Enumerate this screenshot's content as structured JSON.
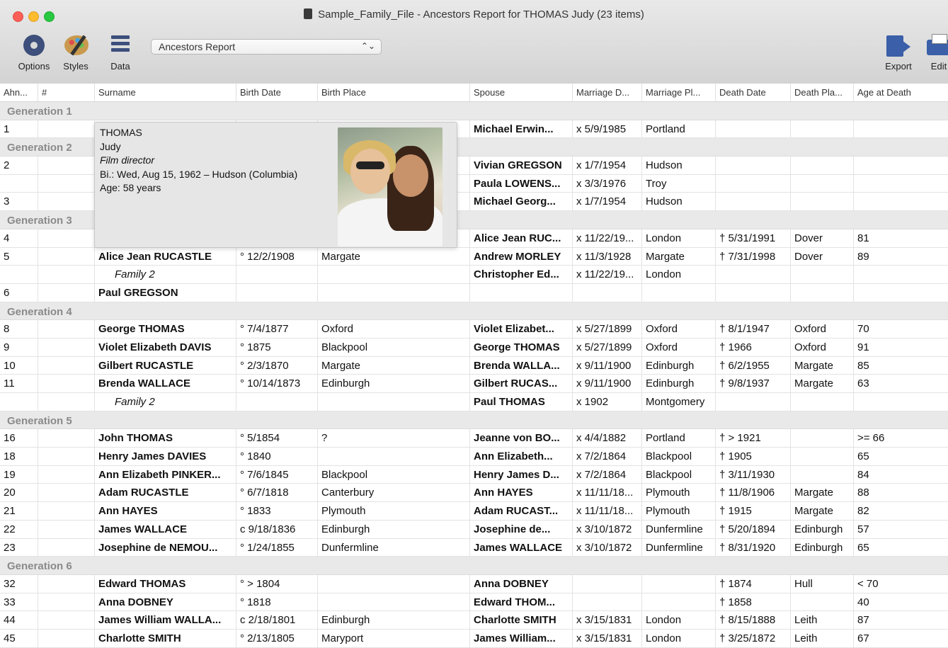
{
  "window": {
    "title": "Sample_Family_File - Ancestors Report for THOMAS Judy (23 items)"
  },
  "toolbar": {
    "options_label": "Options",
    "styles_label": "Styles",
    "data_label": "Data",
    "report_select_value": "Ancestors Report",
    "export_label": "Export",
    "edit_label": "Edit"
  },
  "columns": [
    "Ahn...",
    "#",
    "Surname",
    "Birth Date",
    "Birth Place",
    "Spouse",
    "Marriage D...",
    "Marriage Pl...",
    "Death Date",
    "Death Pla...",
    "Age at Death"
  ],
  "rows": [
    {
      "gen": "Generation 1"
    },
    {
      "cells": [
        "1",
        "",
        "",
        "",
        "",
        "Michael Erwin...",
        "x 5/9/1985",
        "Portland",
        "",
        "",
        ""
      ]
    },
    {
      "gen": "Generation 2"
    },
    {
      "cells": [
        "2",
        "",
        "",
        "",
        "",
        "Vivian GREGSON",
        "x 1/7/1954",
        "Hudson",
        "",
        "",
        ""
      ]
    },
    {
      "cells": [
        "",
        "",
        "",
        "",
        "",
        "Paula LOWENS...",
        "x 3/3/1976",
        "Troy",
        "",
        "",
        ""
      ]
    },
    {
      "cells": [
        "3",
        "",
        "",
        "",
        "",
        "Michael Georg...",
        "x 1/7/1954",
        "Hudson",
        "",
        "",
        ""
      ]
    },
    {
      "gen": "Generation 3"
    },
    {
      "cells": [
        "4",
        "",
        "",
        "",
        "",
        "Alice Jean RUC...",
        "x 11/22/19...",
        "London",
        "† 5/31/1991",
        "Dover",
        "81"
      ]
    },
    {
      "cells": [
        "5",
        "",
        "Alice Jean RUCASTLE",
        "° 12/2/1908",
        "Margate",
        "Andrew MORLEY",
        "x 11/3/1928",
        "Margate",
        "† 7/31/1998",
        "Dover",
        "89"
      ]
    },
    {
      "family": true,
      "cells": [
        "",
        "",
        "Family 2",
        "",
        "",
        "Christopher Ed...",
        "x 11/22/19...",
        "London",
        "",
        "",
        ""
      ]
    },
    {
      "cells": [
        "6",
        "",
        "Paul GREGSON",
        "",
        "",
        "",
        "",
        "",
        "",
        "",
        ""
      ]
    },
    {
      "gen": "Generation 4"
    },
    {
      "cells": [
        "8",
        "",
        "George THOMAS",
        "° 7/4/1877",
        "Oxford",
        "Violet Elizabet...",
        "x 5/27/1899",
        "Oxford",
        "† 8/1/1947",
        "Oxford",
        "70"
      ]
    },
    {
      "cells": [
        "9",
        "",
        "Violet Elizabeth DAVIS",
        "° 1875",
        "Blackpool",
        "George THOMAS",
        "x 5/27/1899",
        "Oxford",
        "† 1966",
        "Oxford",
        "91"
      ]
    },
    {
      "cells": [
        "10",
        "",
        "Gilbert RUCASTLE",
        "° 2/3/1870",
        "Margate",
        "Brenda WALLA...",
        "x 9/11/1900",
        "Edinburgh",
        "† 6/2/1955",
        "Margate",
        "85"
      ]
    },
    {
      "cells": [
        "11",
        "",
        "Brenda WALLACE",
        "° 10/14/1873",
        "Edinburgh",
        "Gilbert RUCAS...",
        "x 9/11/1900",
        "Edinburgh",
        "† 9/8/1937",
        "Margate",
        "63"
      ]
    },
    {
      "family": true,
      "cells": [
        "",
        "",
        "Family 2",
        "",
        "",
        "Paul THOMAS",
        "x 1902",
        "Montgomery",
        "",
        "",
        ""
      ]
    },
    {
      "gen": "Generation 5"
    },
    {
      "cells": [
        "16",
        "",
        "John THOMAS",
        "° 5/1854",
        "?",
        "Jeanne von BO...",
        "x 4/4/1882",
        "Portland",
        "† > 1921",
        "",
        ">= 66"
      ]
    },
    {
      "cells": [
        "18",
        "",
        "Henry James DAVIES",
        "° 1840",
        "",
        "Ann Elizabeth...",
        "x 7/2/1864",
        "Blackpool",
        "† 1905",
        "",
        "65"
      ]
    },
    {
      "cells": [
        "19",
        "",
        "Ann Elizabeth PINKER...",
        "° 7/6/1845",
        "Blackpool",
        "Henry James D...",
        "x 7/2/1864",
        "Blackpool",
        "† 3/11/1930",
        "",
        "84"
      ]
    },
    {
      "cells": [
        "20",
        "",
        "Adam RUCASTLE",
        "° 6/7/1818",
        "Canterbury",
        "Ann HAYES",
        "x 11/11/18...",
        "Plymouth",
        "† 11/8/1906",
        "Margate",
        "88"
      ]
    },
    {
      "cells": [
        "21",
        "",
        "Ann HAYES",
        "° 1833",
        "Plymouth",
        "Adam RUCAST...",
        "x 11/11/18...",
        "Plymouth",
        "† 1915",
        "Margate",
        "82"
      ]
    },
    {
      "cells": [
        "22",
        "",
        "James WALLACE",
        "c 9/18/1836",
        "Edinburgh",
        "Josephine de...",
        "x 3/10/1872",
        "Dunfermline",
        "† 5/20/1894",
        "Edinburgh",
        "57"
      ]
    },
    {
      "cells": [
        "23",
        "",
        "Josephine de NEMOU...",
        "° 1/24/1855",
        "Dunfermline",
        "James WALLACE",
        "x 3/10/1872",
        "Dunfermline",
        "† 8/31/1920",
        "Edinburgh",
        "65"
      ]
    },
    {
      "gen": "Generation 6"
    },
    {
      "cells": [
        "32",
        "",
        "Edward THOMAS",
        "° > 1804",
        "",
        "Anna DOBNEY",
        "",
        "",
        "† 1874",
        "Hull",
        "< 70"
      ]
    },
    {
      "cells": [
        "33",
        "",
        "Anna DOBNEY",
        "° 1818",
        "",
        "Edward THOM...",
        "",
        "",
        "† 1858",
        "",
        "40"
      ]
    },
    {
      "cells": [
        "44",
        "",
        "James William WALLA...",
        "c 2/18/1801",
        "Edinburgh",
        "Charlotte SMITH",
        "x 3/15/1831",
        "London",
        "† 8/15/1888",
        "Leith",
        "87"
      ]
    },
    {
      "cells": [
        "45",
        "",
        "Charlotte SMITH",
        "° 2/13/1805",
        "Maryport",
        "James William...",
        "x 3/15/1831",
        "London",
        "† 3/25/1872",
        "Leith",
        "67"
      ]
    }
  ],
  "popover": {
    "surname": "THOMAS",
    "given": "Judy",
    "occupation": "Film director",
    "birth": "Bi.: Wed, Aug 15, 1962 – Hudson (Columbia)",
    "age": "Age: 58 years"
  },
  "icons": {
    "options": "gear-icon",
    "styles": "palette-icon",
    "data": "checklist-icon",
    "export": "export-icon",
    "edit": "printer-icon"
  }
}
